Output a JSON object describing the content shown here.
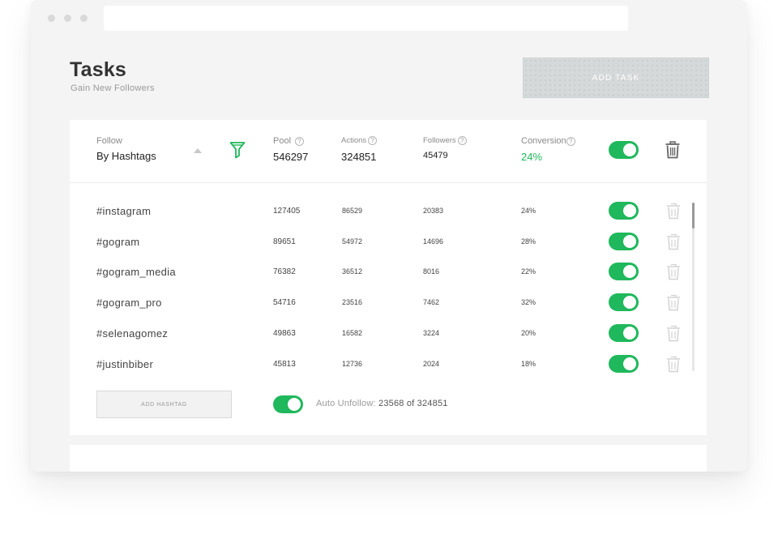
{
  "window": {
    "dots": [
      "window-dot",
      "window-dot",
      "window-dot"
    ]
  },
  "page": {
    "title": "Tasks",
    "subtitle": "Gain New Followers",
    "add_task_label": "ADD TASK"
  },
  "task": {
    "follow_label": "Follow",
    "follow_value": "By Hashtags",
    "pool_label": "Pool",
    "pool_value": "546297",
    "actions_label": "Actions",
    "actions_value": "324851",
    "followers_label": "Followers",
    "followers_value": "45479",
    "conversion_label": "Conversion",
    "conversion_value": "24%",
    "help_glyph": "?",
    "enabled": true,
    "icons": {
      "filter": "funnel-icon",
      "delete": "trash-icon",
      "sort": "caret-up-icon"
    }
  },
  "hashtags": [
    {
      "tag": "#instagram",
      "pool": "127405",
      "actions": "86529",
      "followers": "20383",
      "conversion": "24%",
      "enabled": true
    },
    {
      "tag": "#gogram",
      "pool": "89651",
      "actions": "54972",
      "followers": "14696",
      "conversion": "28%",
      "enabled": true
    },
    {
      "tag": "#gogram_media",
      "pool": "76382",
      "actions": "36512",
      "followers": "8016",
      "conversion": "22%",
      "enabled": true
    },
    {
      "tag": "#gogram_pro",
      "pool": "54716",
      "actions": "23516",
      "followers": "7462",
      "conversion": "32%",
      "enabled": true
    },
    {
      "tag": "#selenagomez",
      "pool": "49863",
      "actions": "16582",
      "followers": "3224",
      "conversion": "20%",
      "enabled": true
    },
    {
      "tag": "#justinbiber",
      "pool": "45813",
      "actions": "12736",
      "followers": "2024",
      "conversion": "18%",
      "enabled": true
    }
  ],
  "footer": {
    "add_hashtag_label": "ADD HASHTAG",
    "auto_unfollow_label": "Auto Unfollow:",
    "auto_unfollow_value": "23568 of 324851",
    "auto_unfollow_enabled": true
  },
  "colors": {
    "accent": "#1fb85c",
    "background": "#f4f4f4",
    "card": "#ffffff"
  }
}
